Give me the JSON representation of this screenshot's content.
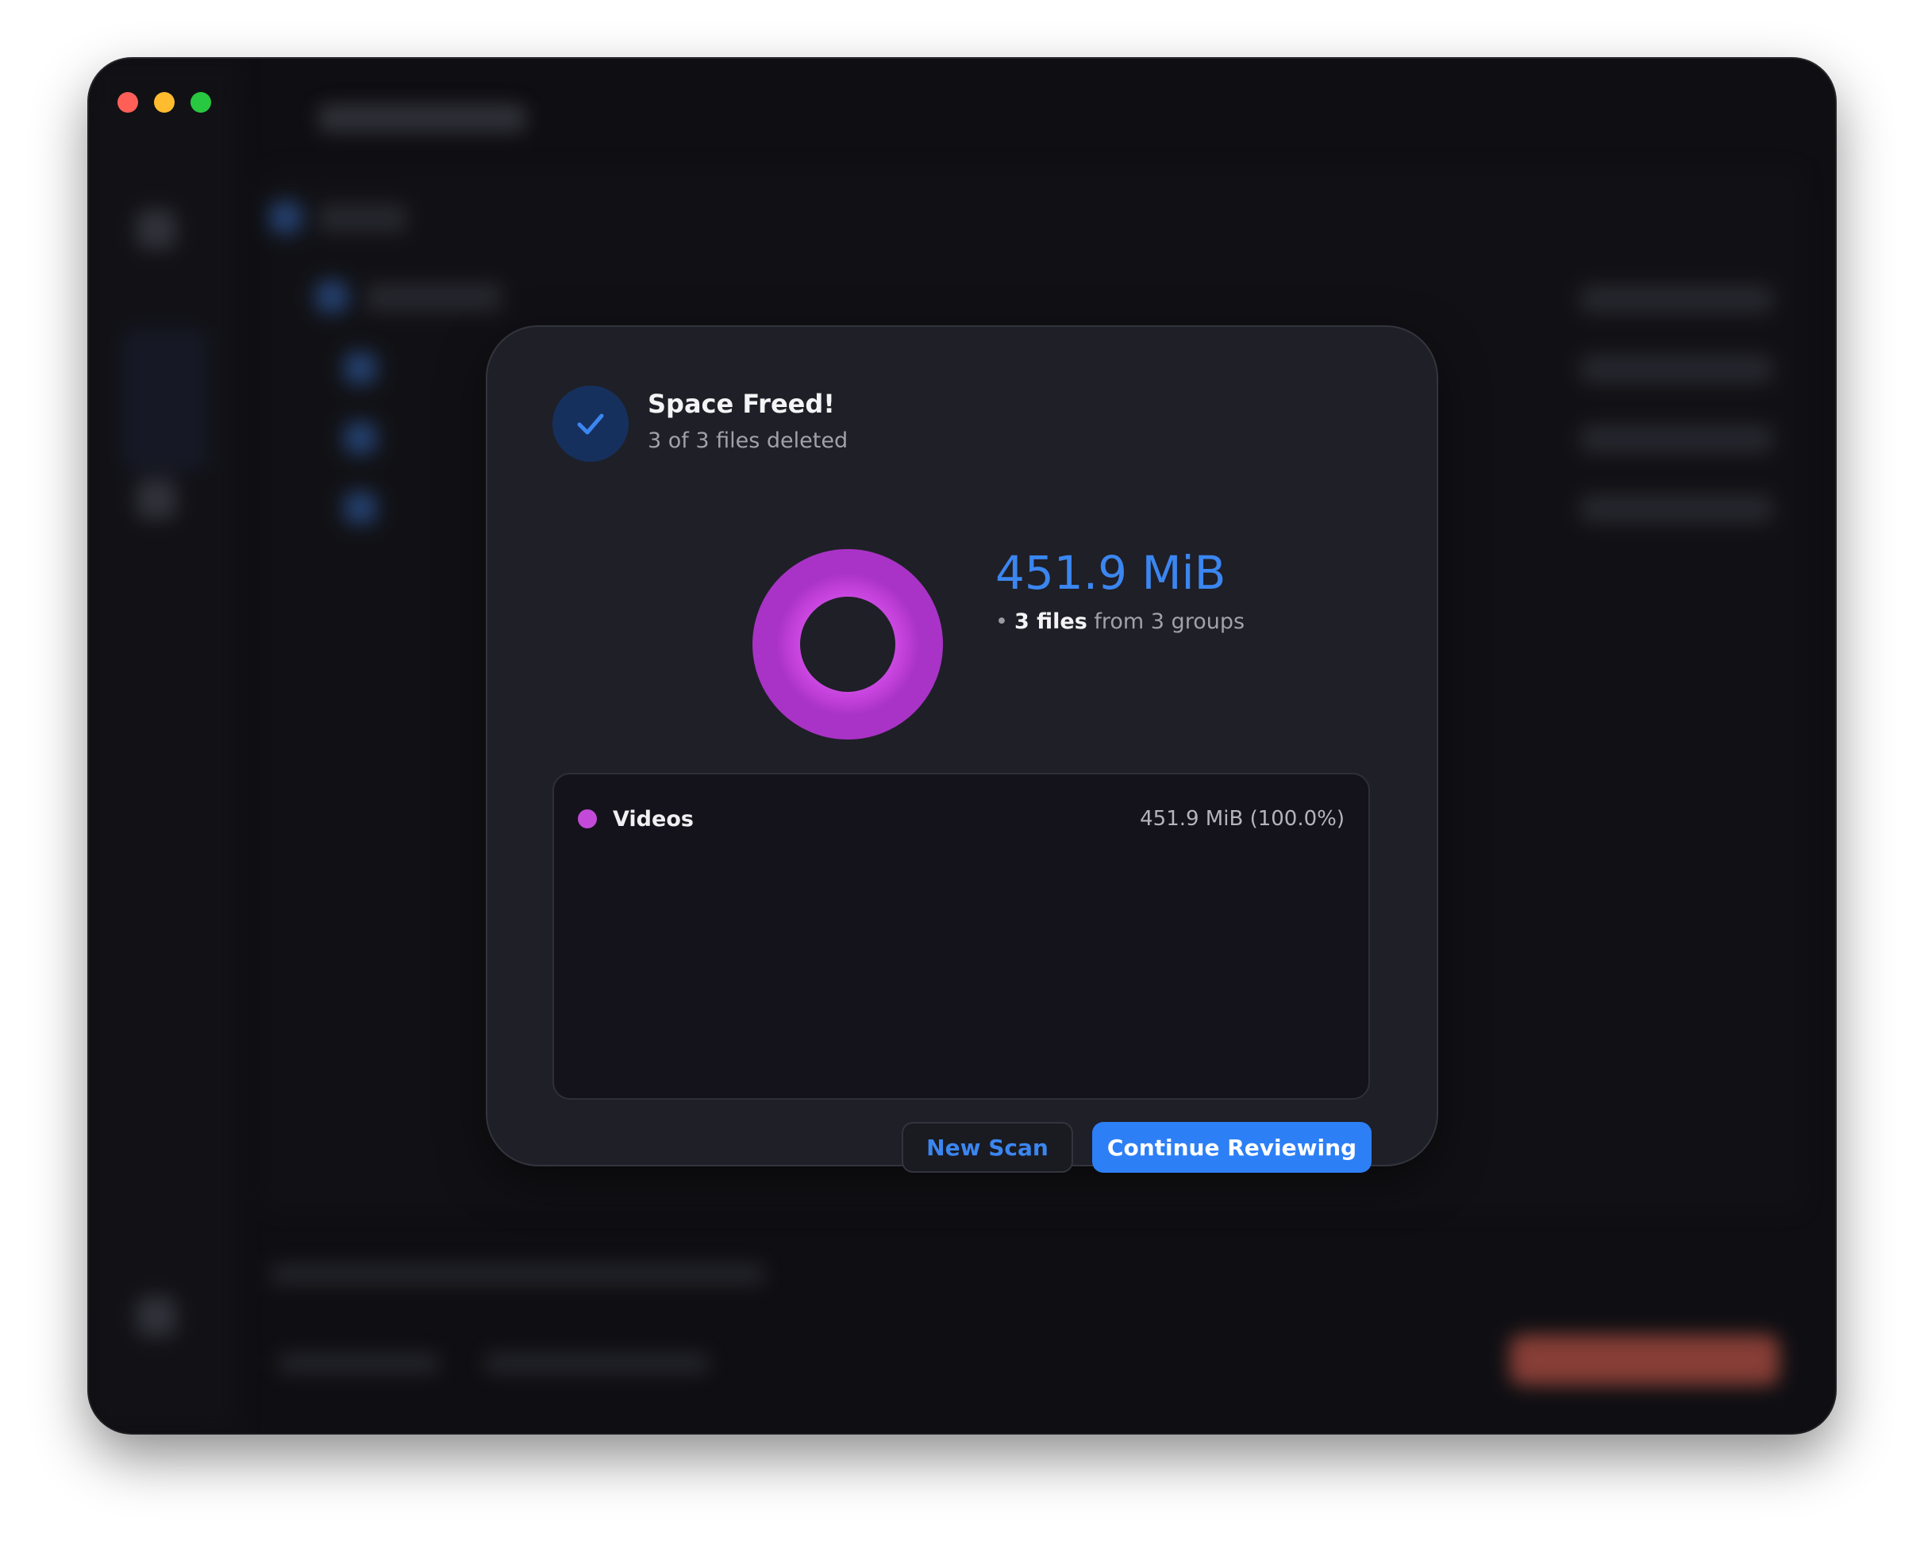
{
  "window": {
    "controls": [
      "close",
      "minimize",
      "zoom"
    ]
  },
  "dialog": {
    "icon": "checkmark-icon",
    "title": "Space Freed!",
    "subtitle": "3 of 3 files deleted",
    "total_size": "451.9 MiB",
    "files_count": "3 files",
    "files_suffix": "from 3 groups",
    "categories": [
      {
        "label": "Videos",
        "value": "451.9 MiB (100.0%)",
        "color": "#c34ad9",
        "fraction": 1.0
      }
    ],
    "buttons": {
      "new_scan": "New Scan",
      "continue": "Continue Reviewing"
    }
  },
  "colors": {
    "accent": "#3b86f0",
    "primary_button": "#2d7ff6",
    "videos": "#c34ad9"
  }
}
